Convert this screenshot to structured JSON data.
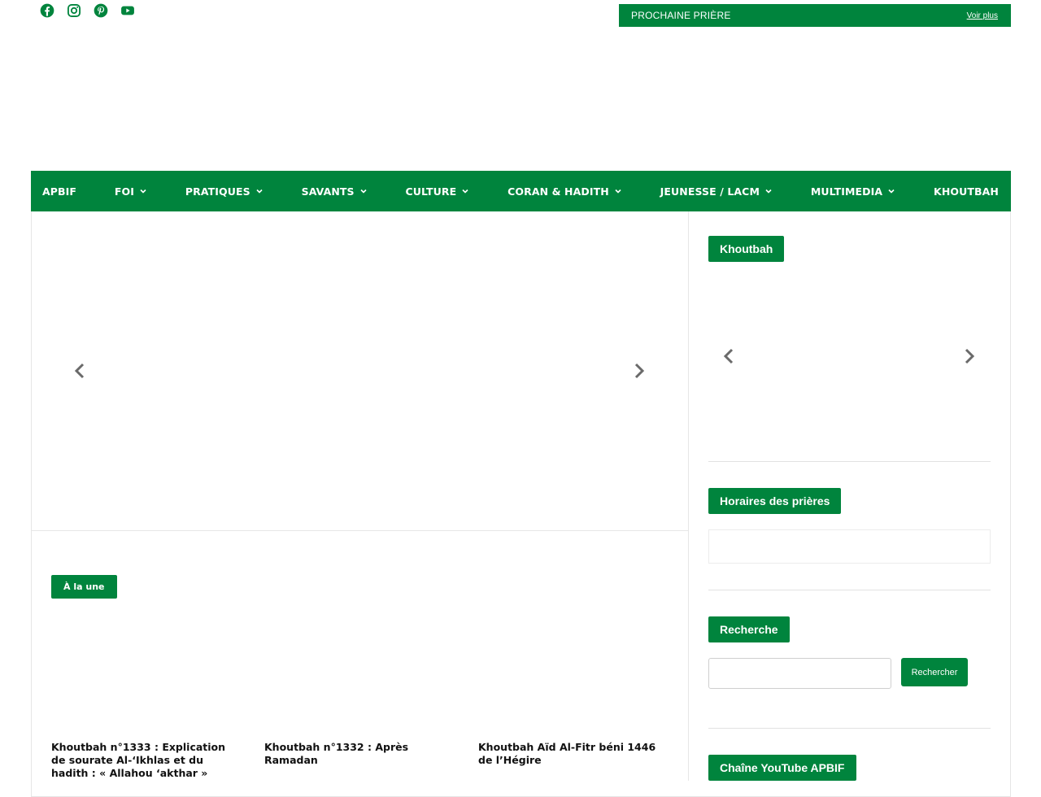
{
  "header": {
    "social_icons": [
      "facebook-icon",
      "instagram-icon",
      "pinterest-icon",
      "youtube-icon"
    ],
    "prayer_bar": {
      "label": "PROCHAINE PRIÈRE",
      "more_link": "Voir plus"
    }
  },
  "nav": {
    "items": [
      {
        "label": "APBIF",
        "has_dropdown": false
      },
      {
        "label": "FOI",
        "has_dropdown": true
      },
      {
        "label": "PRATIQUES",
        "has_dropdown": true
      },
      {
        "label": "SAVANTS",
        "has_dropdown": true
      },
      {
        "label": "CULTURE",
        "has_dropdown": true
      },
      {
        "label": "CORAN & HADITH",
        "has_dropdown": true
      },
      {
        "label": "JEUNESSE / LACM",
        "has_dropdown": true
      },
      {
        "label": "MULTIMEDIA",
        "has_dropdown": true
      },
      {
        "label": "KHOUTBAH",
        "has_dropdown": false
      }
    ]
  },
  "main": {
    "featured_tag": "À la une",
    "articles": [
      {
        "title": "Khoutbah n°1333 : Explication de sourate Al-‘Ikhlas et du hadith : « Allahou ‘akthar »"
      },
      {
        "title": "Khoutbah n°1332 : Après Ramadan"
      },
      {
        "title": "Khoutbah Aïd Al-Fitr béni 1446 de l’Hégire"
      }
    ]
  },
  "sidebar": {
    "khoutbah_title": "Khoutbah",
    "prayer_times_title": "Horaires des prières",
    "search_title": "Recherche",
    "search_input_value": "",
    "search_button": "Rechercher",
    "youtube_title": "Chaîne YouTube APBIF"
  },
  "colors": {
    "accent": "#00843d",
    "text": "#111111",
    "border": "#e6e6e6"
  }
}
